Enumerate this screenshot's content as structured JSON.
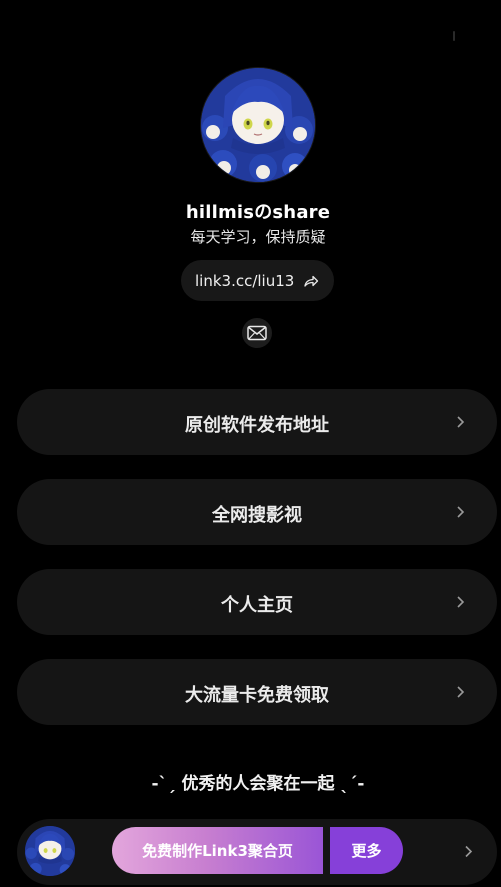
{
  "profile": {
    "name": "hillmisのshare",
    "bio": "每天学习，保持质疑",
    "link": "link3.cc/liu13"
  },
  "icons": {
    "share": "share-arrow-icon",
    "contact": "mail-icon",
    "chevron": "chevron-right-icon"
  },
  "links": [
    {
      "label": "原创软件发布地址"
    },
    {
      "label": "全网搜影视"
    },
    {
      "label": "个人主页"
    },
    {
      "label": "大流量卡免费领取"
    }
  ],
  "slogan": "-ˋˏ 优秀的人会聚在一起 ˎˊ-",
  "footer": {
    "cta_label": "免费制作Link3聚合页",
    "more_label": "更多"
  },
  "colors": {
    "background": "#000000",
    "card": "#151515",
    "cta_gradient_start": "#e3a6dc",
    "cta_gradient_end": "#9a55d6",
    "more_button": "#8640d9"
  }
}
